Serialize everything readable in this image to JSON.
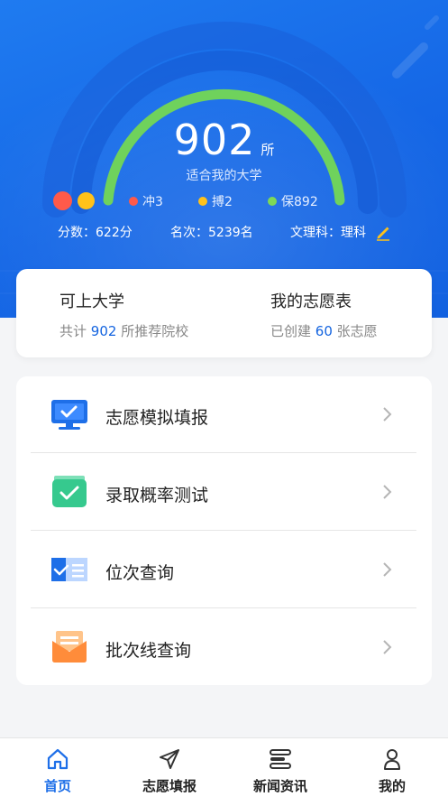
{
  "hero": {
    "count": "902",
    "count_unit": "所",
    "subtitle": "适合我的大学",
    "legend": [
      {
        "label": "冲3",
        "color": "#ff5a4a"
      },
      {
        "label": "搏2",
        "color": "#ffc21a"
      },
      {
        "label": "保892",
        "color": "#7ed957"
      }
    ],
    "score": "分数：622分",
    "rank": "名次：5239名",
    "subject": "文理科：理科"
  },
  "summary": {
    "left_title": "可上大学",
    "left_prefix": "共计",
    "left_value": "902",
    "left_suffix": "所推荐院校",
    "right_title": "我的志愿表",
    "right_prefix": "已创建",
    "right_value": "60",
    "right_suffix": "张志愿"
  },
  "menu": [
    {
      "label": "志愿模拟填报",
      "icon": "monitor-check-icon"
    },
    {
      "label": "录取概率测试",
      "icon": "box-check-icon"
    },
    {
      "label": "位次查询",
      "icon": "list-check-icon"
    },
    {
      "label": "批次线查询",
      "icon": "envelope-icon"
    }
  ],
  "tabs": [
    {
      "label": "首页",
      "icon": "home-icon",
      "active": true
    },
    {
      "label": "志愿填报",
      "icon": "send-icon",
      "active": false
    },
    {
      "label": "新闻资讯",
      "icon": "news-icon",
      "active": false
    },
    {
      "label": "我的",
      "icon": "user-icon",
      "active": false
    }
  ],
  "colors": {
    "accent": "#1e6fe8",
    "arc_green": "#6fd25c",
    "hero_blue": "#1567e6"
  }
}
